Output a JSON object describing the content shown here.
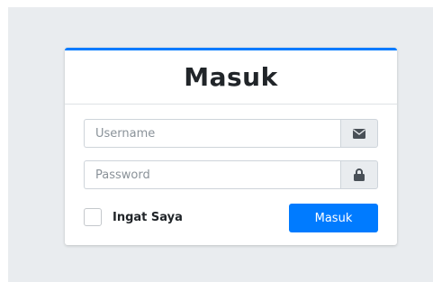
{
  "login": {
    "title": "Masuk",
    "username": {
      "placeholder": "Username",
      "value": "",
      "icon": "envelope-icon"
    },
    "password": {
      "placeholder": "Password",
      "value": "",
      "icon": "lock-icon"
    },
    "remember_label": "Ingat Saya",
    "remember_checked": false,
    "submit_label": "Masuk"
  },
  "colors": {
    "accent": "#007bff",
    "page_background": "#e9ecef",
    "card_background": "#ffffff"
  }
}
